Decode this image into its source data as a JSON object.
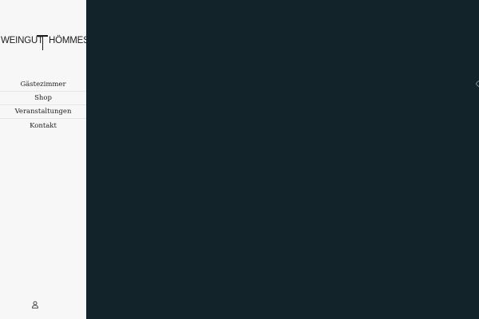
{
  "logo": {
    "left_word": "WEINGUT",
    "right_word": "HÖMMES",
    "monogram": "T"
  },
  "nav": {
    "items": [
      {
        "label": "Gästezimmer"
      },
      {
        "label": "Shop"
      },
      {
        "label": "Veranstaltungen"
      },
      {
        "label": "Kontakt"
      }
    ]
  },
  "icons": {
    "account": "user-icon",
    "slider_next": "chevron-left-icon"
  },
  "colors": {
    "sidebar_bg": "#f7f7f7",
    "main_bg": "#13232a"
  }
}
